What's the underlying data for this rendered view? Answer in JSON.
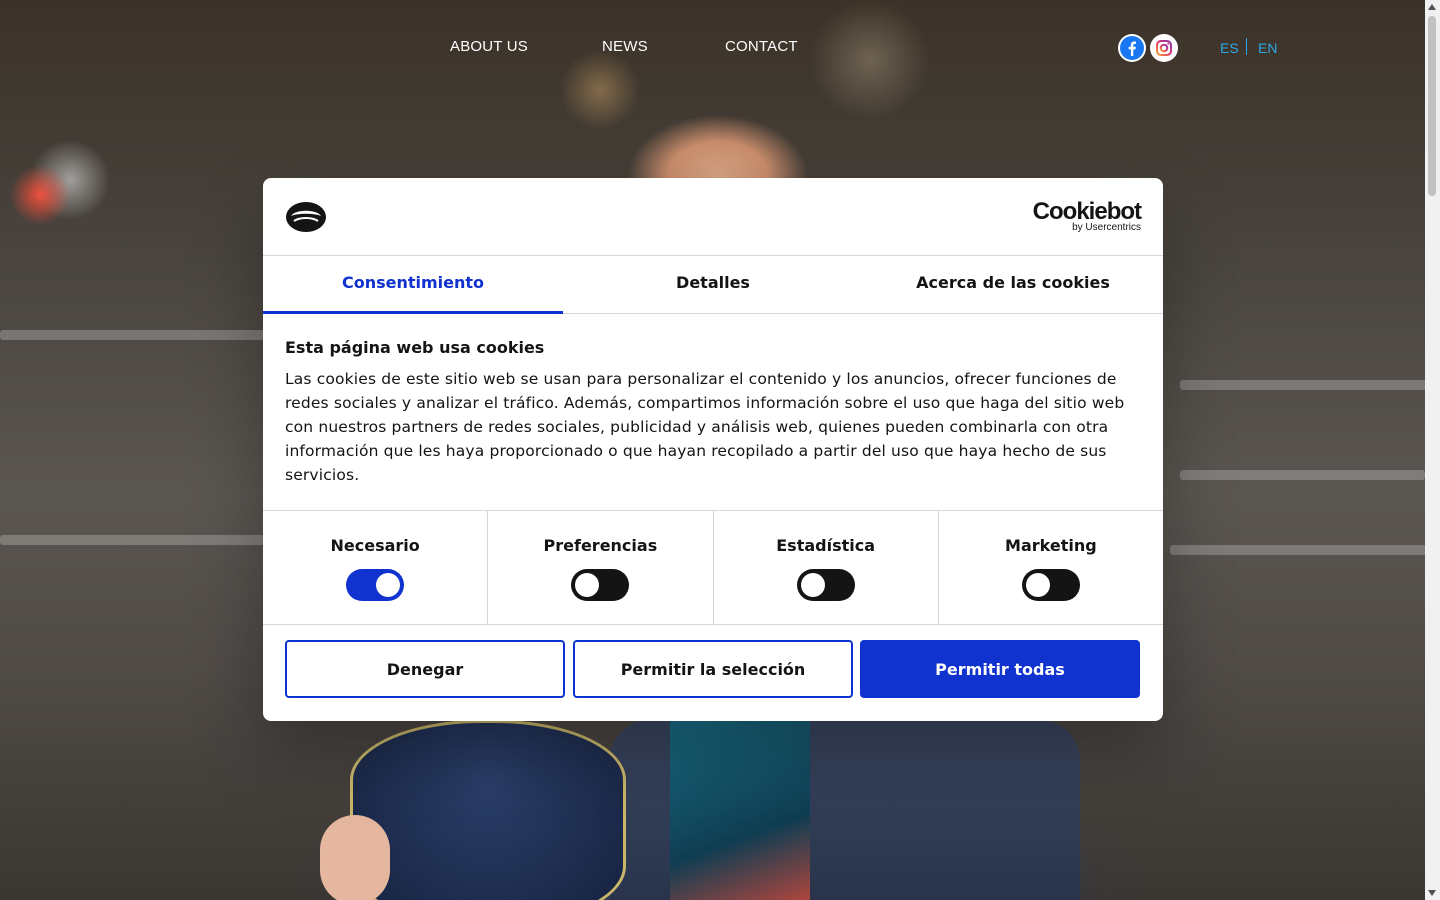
{
  "nav": {
    "links": [
      "ABOUT US",
      "NEWS",
      "CONTACT"
    ],
    "social": [
      "facebook-icon",
      "instagram-icon"
    ],
    "languages": [
      "ES",
      "EN"
    ]
  },
  "dialog": {
    "brand": "Cookiebot",
    "brand_sub": "by Usercentrics",
    "tabs": [
      "Consentimiento",
      "Detalles",
      "Acerca de las cookies"
    ],
    "active_tab": "Consentimiento",
    "title": "Esta página web usa cookies",
    "text": "Las cookies de este sitio web se usan para personalizar el contenido y los anuncios, ofrecer funciones de redes sociales y analizar el tráfico. Además, compartimos información sobre el uso que haga del sitio web con nuestros partners de redes sociales, publicidad y análisis web, quienes pueden combinarla con otra información que les haya proporcionado o que hayan recopilado a partir del uso que haya hecho de sus servicios.",
    "toggles": [
      {
        "label": "Necesario",
        "on": true
      },
      {
        "label": "Preferencias",
        "on": false
      },
      {
        "label": "Estadística",
        "on": false
      },
      {
        "label": "Marketing",
        "on": false
      }
    ],
    "buttons": {
      "deny": "Denegar",
      "allow_selection": "Permitir la selección",
      "allow_all": "Permitir todas"
    }
  },
  "colors": {
    "accent": "#1032cf",
    "lang": "#2ea6e6"
  }
}
